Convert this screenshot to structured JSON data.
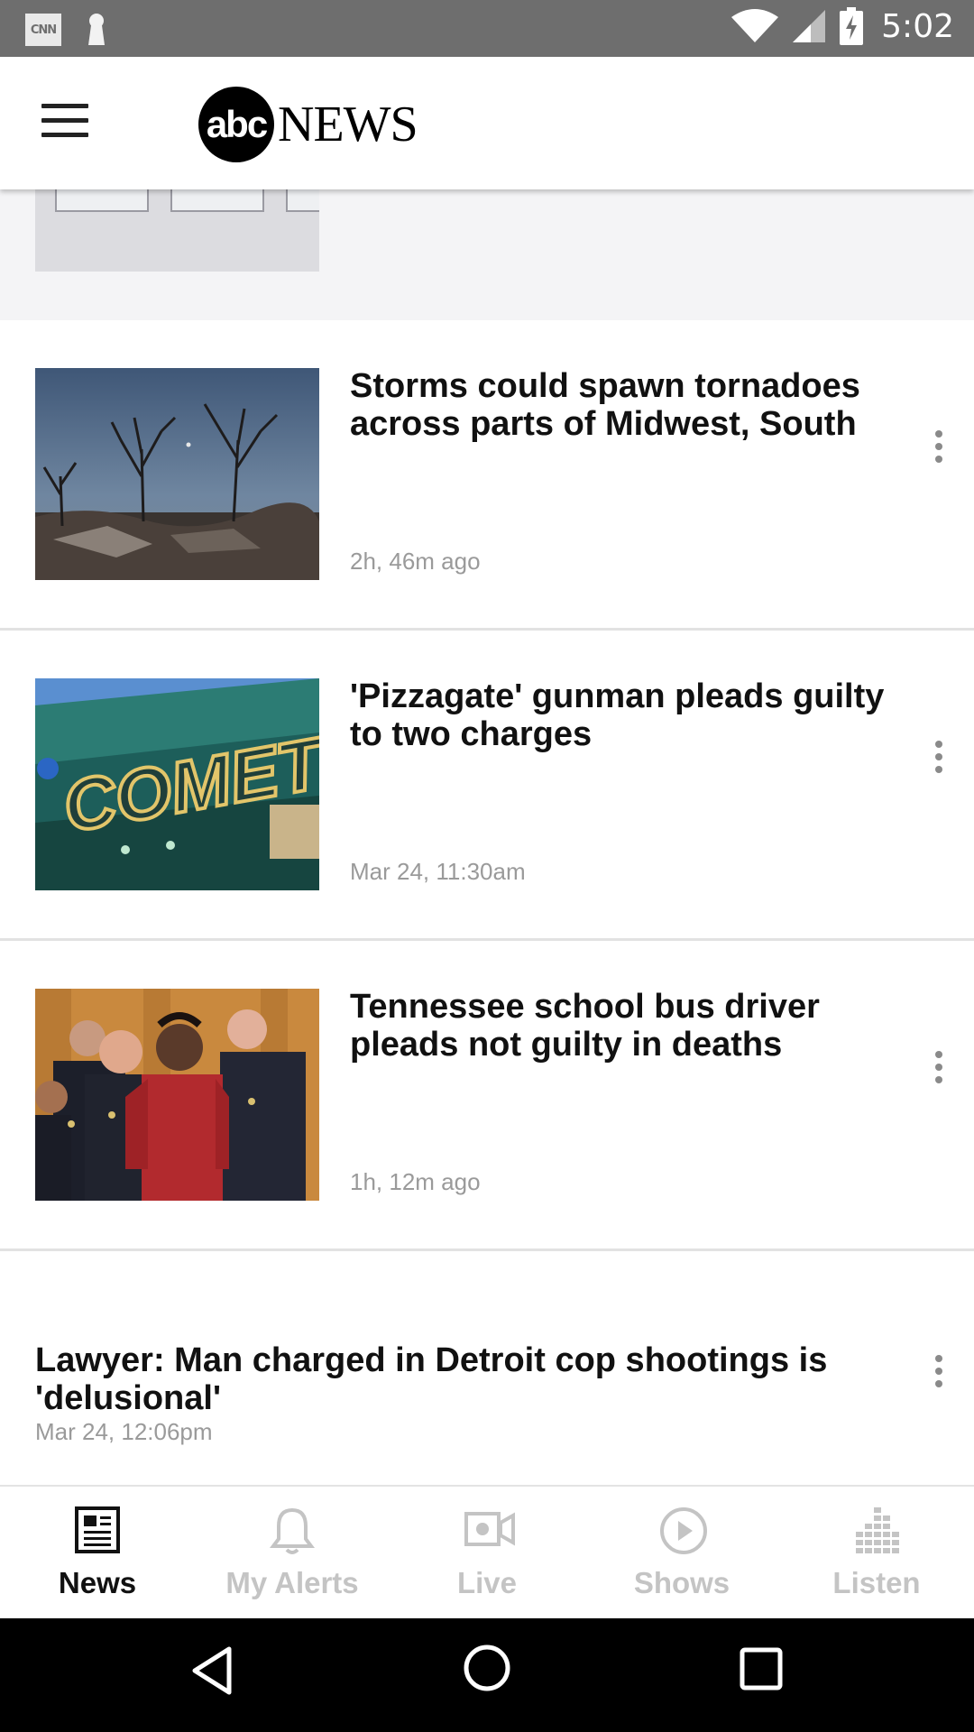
{
  "status_bar": {
    "notification_icons": [
      "cnn-icon",
      "keyhole-icon"
    ],
    "cnn_label": "CNN",
    "time": "5:02"
  },
  "header": {
    "logo_abc": "abc",
    "logo_news": "NEWS"
  },
  "stories": [
    {
      "title": "Storms could spawn tornadoes across parts of Midwest, South",
      "time": "2h, 46m ago",
      "thumbnail": "storm-damage-trees"
    },
    {
      "title": "'Pizzagate' gunman pleads guilty to two charges",
      "time": "Mar 24, 11:30am",
      "thumbnail": "comet-sign"
    },
    {
      "title": "Tennessee school bus driver pleads not guilty in deaths",
      "time": "1h, 12m ago",
      "thumbnail": "courtroom-defendant"
    },
    {
      "title": "Lawyer: Man charged in Detroit cop shootings is 'delusional'",
      "time": "Mar 24, 12:06pm"
    }
  ],
  "tabs": [
    {
      "label": "News",
      "icon": "newspaper-icon",
      "active": true
    },
    {
      "label": "My Alerts",
      "icon": "bell-icon",
      "active": false
    },
    {
      "label": "Live",
      "icon": "video-camera-icon",
      "active": false
    },
    {
      "label": "Shows",
      "icon": "play-circle-icon",
      "active": false
    },
    {
      "label": "Listen",
      "icon": "equalizer-icon",
      "active": false
    }
  ],
  "colors": {
    "status_bar": "#6e6e6e",
    "active_tab": "#111111",
    "inactive_tab": "#c4c4c4",
    "timestamp": "#9a9a9a"
  }
}
